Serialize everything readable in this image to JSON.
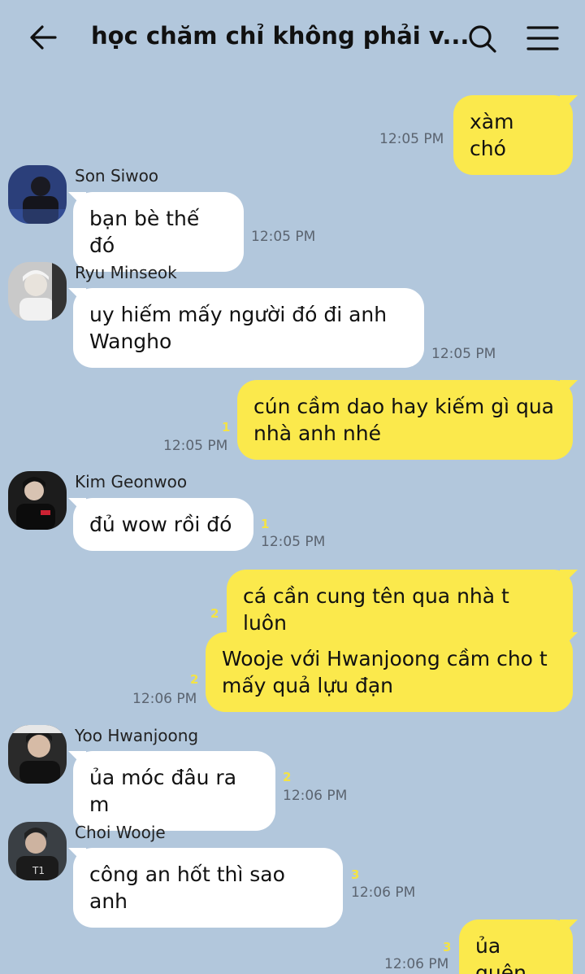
{
  "header": {
    "title": "học chăm chỉ không phải v...",
    "back_icon": "arrow-left-icon",
    "search_icon": "search-icon",
    "menu_icon": "hamburger-menu-icon"
  },
  "messages": [
    {
      "dir": "out",
      "text": "xàm chó",
      "time": "12:05 PM",
      "unread": ""
    },
    {
      "dir": "in",
      "sender": "Son Siwoo",
      "text": "bạn bè thế đó",
      "time": "12:05 PM",
      "unread": ""
    },
    {
      "dir": "in",
      "sender": "Ryu Minseok",
      "text": "uy hiếm mấy người đó đi anh Wangho",
      "time": "12:05 PM",
      "unread": ""
    },
    {
      "dir": "out",
      "text": "cún cầm dao hay kiếm gì qua nhà anh nhé",
      "time": "12:05 PM",
      "unread": "1"
    },
    {
      "dir": "in",
      "sender": "Kim Geonwoo",
      "text": "đủ wow rồi đó",
      "time": "12:05 PM",
      "unread": "1"
    },
    {
      "dir": "out",
      "text": "cá cần cung tên qua nhà t luôn",
      "time": "",
      "unread": "2"
    },
    {
      "dir": "out",
      "text": "Wooje với Hwanjoong cầm cho t mấy quả lựu đạn",
      "time": "12:06 PM",
      "unread": "2"
    },
    {
      "dir": "in",
      "sender": "Yoo Hwanjoong",
      "text": "ủa móc đâu ra m",
      "time": "12:06 PM",
      "unread": "2"
    },
    {
      "dir": "in",
      "sender": "Choi Wooje",
      "text": "công an hốt thì sao anh",
      "time": "12:06 PM",
      "unread": "3"
    },
    {
      "dir": "out",
      "text": "ủa quên",
      "time": "12:06 PM",
      "unread": "3"
    }
  ]
}
